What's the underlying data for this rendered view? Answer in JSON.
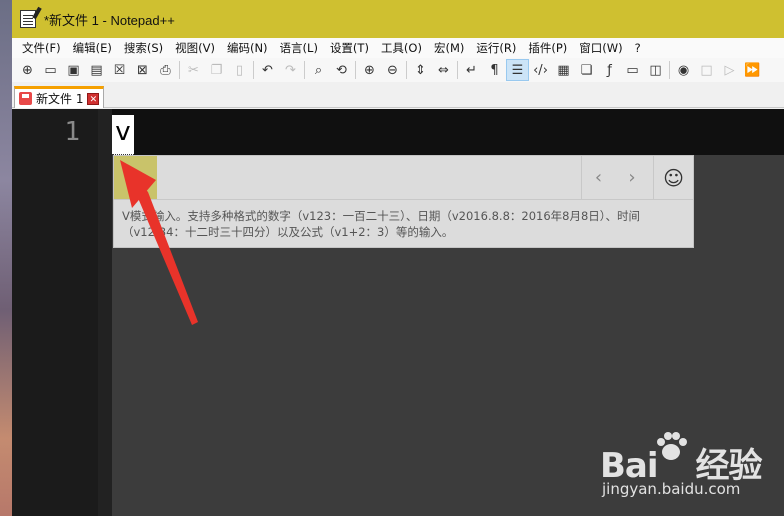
{
  "window": {
    "title": "*新文件 1 - Notepad++",
    "accent_color": "#cfc030"
  },
  "menu": [
    "文件(F)",
    "编辑(E)",
    "搜索(S)",
    "视图(V)",
    "编码(N)",
    "语言(L)",
    "设置(T)",
    "工具(O)",
    "宏(M)",
    "运行(R)",
    "插件(P)",
    "窗口(W)",
    "?"
  ],
  "toolbar": {
    "icons": [
      "new-file-icon",
      "open-file-icon",
      "save-icon",
      "save-all-icon",
      "close-icon",
      "close-all-icon",
      "print-icon",
      "cut-icon",
      "copy-icon",
      "paste-icon",
      "undo-icon",
      "redo-icon",
      "find-icon",
      "replace-icon",
      "zoom-in-icon",
      "zoom-out-icon",
      "sync-vertical-icon",
      "sync-horizontal-icon",
      "word-wrap-icon",
      "show-all-chars-icon",
      "indent-guide-icon",
      "xml-tag-icon",
      "doc-map-icon",
      "doc-list-icon",
      "function-list-icon",
      "monitor-icon",
      "folder-workspace-icon",
      "record-macro-icon",
      "stop-record-icon",
      "play-macro-icon",
      "run-macro-multiple-icon"
    ]
  },
  "tabs": [
    {
      "label": "新文件 1"
    }
  ],
  "editor": {
    "line_number": "1",
    "typed_text": "v"
  },
  "ime": {
    "hint": "V模式输入。支持多种格式的数字（v123：一百二十三）、日期（v2016.8.8：2016年8月8日）、时间（v12:34：十二时三十四分）以及公式（v1+2：3）等的输入。",
    "prev_symbol": "‹",
    "next_symbol": "›",
    "emoji_symbol": "☺"
  },
  "watermark": {
    "logo": "Bai",
    "logo_suffix": "经验",
    "url": "jingyan.baidu.com"
  }
}
